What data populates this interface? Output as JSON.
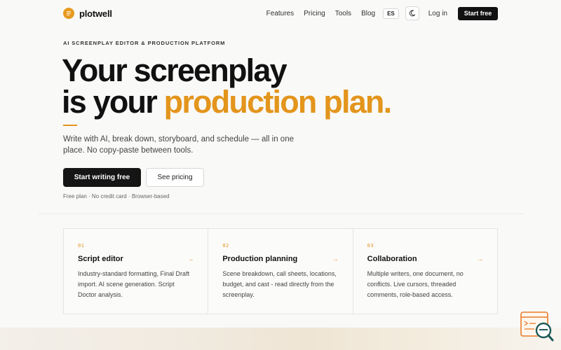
{
  "nav": {
    "brand": "plotwell",
    "links": [
      "Features",
      "Pricing",
      "Tools",
      "Blog"
    ],
    "lang": "ES",
    "login": "Log in",
    "start_free": "Start free"
  },
  "hero": {
    "eyebrow": "AI SCREENPLAY EDITOR & PRODUCTION PLATFORM",
    "headline_line1": "Your screenplay",
    "headline_line2_plain": "is your ",
    "headline_line2_accent": "production plan.",
    "subtitle": "Write with AI, break down, storyboard, and schedule — all in one place. No copy-paste between tools.",
    "cta_primary": "Start writing free",
    "cta_secondary": "See pricing",
    "note": "Free plan · No credit card · Browser-based"
  },
  "features": [
    {
      "num": "01",
      "title": "Script editor",
      "desc": "Industry-standard formatting, Final Draft import. AI scene generation. Script Doctor analysis."
    },
    {
      "num": "02",
      "title": "Production planning",
      "desc": "Scene breakdown, call sheets, locations, budget, and cast - read directly from the screenplay."
    },
    {
      "num": "03",
      "title": "Collaboration",
      "desc": "Multiple writers, one document, no conflicts. Live cursors, threaded comments, role-based access."
    }
  ],
  "colors": {
    "accent": "#e3951c",
    "primary_button": "#151515"
  },
  "icons": {
    "logo": "plotwell-logo-icon",
    "theme": "moon-icon",
    "arrow": "arrow-right-icon",
    "widget": "chat-search-icon"
  }
}
